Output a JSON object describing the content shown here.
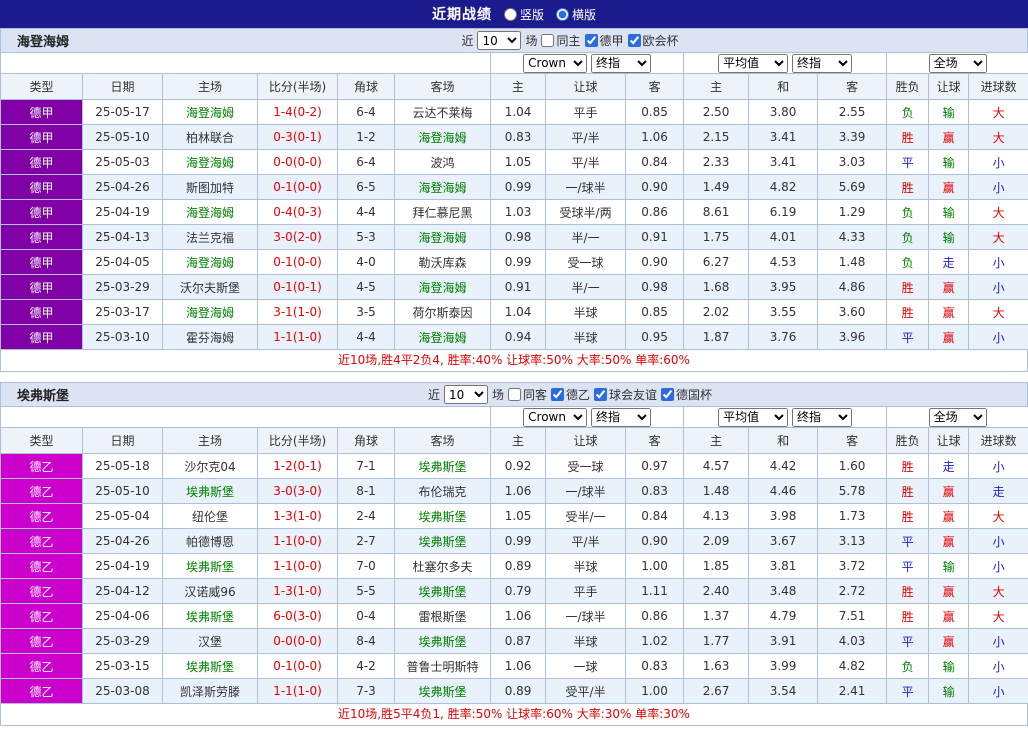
{
  "topbar": {
    "title": "近期战绩",
    "layout_options": [
      {
        "label": "竖版",
        "checked": false
      },
      {
        "label": "横版",
        "checked": true
      }
    ]
  },
  "columns": [
    "类型",
    "日期",
    "主场",
    "比分(半场)",
    "角球",
    "客场",
    "主",
    "让球",
    "客",
    "主",
    "和",
    "客",
    "胜负",
    "让球",
    "进球数"
  ],
  "colors": {
    "topbar_bg": "#1b1b8e",
    "league_bundesliga": "#8000a6",
    "league_bundesliga2": "#cc00cc",
    "focus_team": "#008000",
    "win_red": "#e60000",
    "draw_blue": "#1f1fc8",
    "loss_green": "#008000",
    "row_alt": "#e9f1fb",
    "grid": "#aebfd9"
  },
  "sections": [
    {
      "team": "海登海姆",
      "filter": {
        "prefix": "近",
        "count": "10",
        "suffix": "场",
        "checks": [
          {
            "label": "同主",
            "checked": false
          },
          {
            "label": "德甲",
            "checked": true
          },
          {
            "label": "欧会杯",
            "checked": true
          }
        ]
      },
      "selects": {
        "company": "Crown",
        "ah_final": "终指",
        "eu_avg": "平均值",
        "eu_final": "终指",
        "scope": "全场"
      },
      "summary": "近10场,胜4平2负4, 胜率:40% 让球率:50% 大率:50% 单率:60%",
      "rows": [
        {
          "league": "德甲",
          "league_c": "purple",
          "date": "25-05-17",
          "home": "海登海姆",
          "home_c": "green",
          "score": "1-4(0-2)",
          "corner": "6-4",
          "away": "云达不莱梅",
          "away_c": "dark",
          "ah_home": "1.04",
          "ah_line": "平手",
          "ah_away": "0.85",
          "eu_home": "2.50",
          "eu_draw": "3.80",
          "eu_away": "2.55",
          "result": "负",
          "result_c": "green",
          "handicap": "输",
          "handicap_c": "green",
          "goals": "大",
          "goals_c": "red"
        },
        {
          "league": "德甲",
          "league_c": "purple",
          "date": "25-05-10",
          "home": "柏林联合",
          "home_c": "dark",
          "score": "0-3(0-1)",
          "corner": "1-2",
          "away": "海登海姆",
          "away_c": "green",
          "ah_home": "0.83",
          "ah_line": "平/半",
          "ah_away": "1.06",
          "eu_home": "2.15",
          "eu_draw": "3.41",
          "eu_away": "3.39",
          "result": "胜",
          "result_c": "red",
          "handicap": "赢",
          "handicap_c": "red",
          "goals": "大",
          "goals_c": "red"
        },
        {
          "league": "德甲",
          "league_c": "purple",
          "date": "25-05-03",
          "home": "海登海姆",
          "home_c": "green",
          "score": "0-0(0-0)",
          "corner": "6-4",
          "away": "波鸿",
          "away_c": "dark",
          "ah_home": "1.05",
          "ah_line": "平/半",
          "ah_away": "0.84",
          "eu_home": "2.33",
          "eu_draw": "3.41",
          "eu_away": "3.03",
          "result": "平",
          "result_c": "blue",
          "handicap": "输",
          "handicap_c": "green",
          "goals": "小",
          "goals_c": "blue"
        },
        {
          "league": "德甲",
          "league_c": "purple",
          "date": "25-04-26",
          "home": "斯图加特",
          "home_c": "dark",
          "score": "0-1(0-0)",
          "corner": "6-5",
          "away": "海登海姆",
          "away_c": "green",
          "ah_home": "0.99",
          "ah_line": "一/球半",
          "ah_away": "0.90",
          "eu_home": "1.49",
          "eu_draw": "4.82",
          "eu_away": "5.69",
          "result": "胜",
          "result_c": "red",
          "handicap": "赢",
          "handicap_c": "red",
          "goals": "小",
          "goals_c": "blue"
        },
        {
          "league": "德甲",
          "league_c": "purple",
          "date": "25-04-19",
          "home": "海登海姆",
          "home_c": "green",
          "score": "0-4(0-3)",
          "corner": "4-4",
          "away": "拜仁慕尼黑",
          "away_c": "dark",
          "ah_home": "1.03",
          "ah_line": "受球半/两",
          "ah_away": "0.86",
          "eu_home": "8.61",
          "eu_draw": "6.19",
          "eu_away": "1.29",
          "result": "负",
          "result_c": "green",
          "handicap": "输",
          "handicap_c": "green",
          "goals": "大",
          "goals_c": "red"
        },
        {
          "league": "德甲",
          "league_c": "purple",
          "date": "25-04-13",
          "home": "法兰克福",
          "home_c": "dark",
          "score": "3-0(2-0)",
          "corner": "5-3",
          "away": "海登海姆",
          "away_c": "green",
          "ah_home": "0.98",
          "ah_line": "半/一",
          "ah_away": "0.91",
          "eu_home": "1.75",
          "eu_draw": "4.01",
          "eu_away": "4.33",
          "result": "负",
          "result_c": "green",
          "handicap": "输",
          "handicap_c": "green",
          "goals": "大",
          "goals_c": "red"
        },
        {
          "league": "德甲",
          "league_c": "purple",
          "date": "25-04-05",
          "home": "海登海姆",
          "home_c": "green",
          "score": "0-1(0-0)",
          "corner": "4-0",
          "away": "勒沃库森",
          "away_c": "dark",
          "ah_home": "0.99",
          "ah_line": "受一球",
          "ah_away": "0.90",
          "eu_home": "6.27",
          "eu_draw": "4.53",
          "eu_away": "1.48",
          "result": "负",
          "result_c": "green",
          "handicap": "走",
          "handicap_c": "blue",
          "goals": "小",
          "goals_c": "blue"
        },
        {
          "league": "德甲",
          "league_c": "purple",
          "date": "25-03-29",
          "home": "沃尔夫斯堡",
          "home_c": "dark",
          "score": "0-1(0-1)",
          "corner": "4-5",
          "away": "海登海姆",
          "away_c": "green",
          "ah_home": "0.91",
          "ah_line": "半/一",
          "ah_away": "0.98",
          "eu_home": "1.68",
          "eu_draw": "3.95",
          "eu_away": "4.86",
          "result": "胜",
          "result_c": "red",
          "handicap": "赢",
          "handicap_c": "red",
          "goals": "小",
          "goals_c": "blue"
        },
        {
          "league": "德甲",
          "league_c": "purple",
          "date": "25-03-17",
          "home": "海登海姆",
          "home_c": "green",
          "score": "3-1(1-0)",
          "corner": "3-5",
          "away": "荷尔斯泰因",
          "away_c": "dark",
          "ah_home": "1.04",
          "ah_line": "半球",
          "ah_away": "0.85",
          "eu_home": "2.02",
          "eu_draw": "3.55",
          "eu_away": "3.60",
          "result": "胜",
          "result_c": "red",
          "handicap": "赢",
          "handicap_c": "red",
          "goals": "大",
          "goals_c": "red"
        },
        {
          "league": "德甲",
          "league_c": "purple",
          "date": "25-03-10",
          "home": "霍芬海姆",
          "home_c": "dark",
          "score": "1-1(1-0)",
          "corner": "4-4",
          "away": "海登海姆",
          "away_c": "green",
          "ah_home": "0.94",
          "ah_line": "半球",
          "ah_away": "0.95",
          "eu_home": "1.87",
          "eu_draw": "3.76",
          "eu_away": "3.96",
          "result": "平",
          "result_c": "blue",
          "handicap": "赢",
          "handicap_c": "red",
          "goals": "小",
          "goals_c": "blue"
        }
      ]
    },
    {
      "team": "埃弗斯堡",
      "filter": {
        "prefix": "近",
        "count": "10",
        "suffix": "场",
        "checks": [
          {
            "label": "同客",
            "checked": false
          },
          {
            "label": "德乙",
            "checked": true
          },
          {
            "label": "球会友谊",
            "checked": true
          },
          {
            "label": "德国杯",
            "checked": true
          }
        ]
      },
      "selects": {
        "company": "Crown",
        "ah_final": "终指",
        "eu_avg": "平均值",
        "eu_final": "终指",
        "scope": "全场"
      },
      "summary": "近10场,胜5平4负1, 胜率:50% 让球率:60% 大率:30% 单率:30%",
      "rows": [
        {
          "league": "德乙",
          "league_c": "magenta",
          "date": "25-05-18",
          "home": "沙尔克04",
          "home_c": "dark",
          "score": "1-2(0-1)",
          "corner": "7-1",
          "away": "埃弗斯堡",
          "away_c": "green",
          "ah_home": "0.92",
          "ah_line": "受一球",
          "ah_away": "0.97",
          "eu_home": "4.57",
          "eu_draw": "4.42",
          "eu_away": "1.60",
          "result": "胜",
          "result_c": "red",
          "handicap": "走",
          "handicap_c": "blue",
          "goals": "小",
          "goals_c": "blue"
        },
        {
          "league": "德乙",
          "league_c": "magenta",
          "date": "25-05-10",
          "home": "埃弗斯堡",
          "home_c": "green",
          "score": "3-0(3-0)",
          "corner": "8-1",
          "away": "布伦瑞克",
          "away_c": "dark",
          "ah_home": "1.06",
          "ah_line": "一/球半",
          "ah_away": "0.83",
          "eu_home": "1.48",
          "eu_draw": "4.46",
          "eu_away": "5.78",
          "result": "胜",
          "result_c": "red",
          "handicap": "赢",
          "handicap_c": "red",
          "goals": "走",
          "goals_c": "blue"
        },
        {
          "league": "德乙",
          "league_c": "magenta",
          "date": "25-05-04",
          "home": "纽伦堡",
          "home_c": "dark",
          "score": "1-3(1-0)",
          "corner": "2-4",
          "away": "埃弗斯堡",
          "away_c": "green",
          "ah_home": "1.05",
          "ah_line": "受半/一",
          "ah_away": "0.84",
          "eu_home": "4.13",
          "eu_draw": "3.98",
          "eu_away": "1.73",
          "result": "胜",
          "result_c": "red",
          "handicap": "赢",
          "handicap_c": "red",
          "goals": "大",
          "goals_c": "red"
        },
        {
          "league": "德乙",
          "league_c": "magenta",
          "date": "25-04-26",
          "home": "帕德博恩",
          "home_c": "dark",
          "score": "1-1(0-0)",
          "corner": "2-7",
          "away": "埃弗斯堡",
          "away_c": "green",
          "ah_home": "0.99",
          "ah_line": "平/半",
          "ah_away": "0.90",
          "eu_home": "2.09",
          "eu_draw": "3.67",
          "eu_away": "3.13",
          "result": "平",
          "result_c": "blue",
          "handicap": "赢",
          "handicap_c": "red",
          "goals": "小",
          "goals_c": "blue"
        },
        {
          "league": "德乙",
          "league_c": "magenta",
          "date": "25-04-19",
          "home": "埃弗斯堡",
          "home_c": "green",
          "score": "1-1(0-0)",
          "corner": "7-0",
          "away": "杜塞尔多夫",
          "away_c": "dark",
          "ah_home": "0.89",
          "ah_line": "半球",
          "ah_away": "1.00",
          "eu_home": "1.85",
          "eu_draw": "3.81",
          "eu_away": "3.72",
          "result": "平",
          "result_c": "blue",
          "handicap": "输",
          "handicap_c": "green",
          "goals": "小",
          "goals_c": "blue"
        },
        {
          "league": "德乙",
          "league_c": "magenta",
          "date": "25-04-12",
          "home": "汉诺威96",
          "home_c": "dark",
          "score": "1-3(1-0)",
          "corner": "5-5",
          "away": "埃弗斯堡",
          "away_c": "green",
          "ah_home": "0.79",
          "ah_line": "平手",
          "ah_away": "1.11",
          "eu_home": "2.40",
          "eu_draw": "3.48",
          "eu_away": "2.72",
          "result": "胜",
          "result_c": "red",
          "handicap": "赢",
          "handicap_c": "red",
          "goals": "大",
          "goals_c": "red"
        },
        {
          "league": "德乙",
          "league_c": "magenta",
          "date": "25-04-06",
          "home": "埃弗斯堡",
          "home_c": "green",
          "score": "6-0(3-0)",
          "corner": "0-4",
          "away": "雷根斯堡",
          "away_c": "dark",
          "ah_home": "1.06",
          "ah_line": "一/球半",
          "ah_away": "0.86",
          "eu_home": "1.37",
          "eu_draw": "4.79",
          "eu_away": "7.51",
          "result": "胜",
          "result_c": "red",
          "handicap": "赢",
          "handicap_c": "red",
          "goals": "大",
          "goals_c": "red"
        },
        {
          "league": "德乙",
          "league_c": "magenta",
          "date": "25-03-29",
          "home": "汉堡",
          "home_c": "dark",
          "score": "0-0(0-0)",
          "corner": "8-4",
          "away": "埃弗斯堡",
          "away_c": "green",
          "ah_home": "0.87",
          "ah_line": "半球",
          "ah_away": "1.02",
          "eu_home": "1.77",
          "eu_draw": "3.91",
          "eu_away": "4.03",
          "result": "平",
          "result_c": "blue",
          "handicap": "赢",
          "handicap_c": "red",
          "goals": "小",
          "goals_c": "blue"
        },
        {
          "league": "德乙",
          "league_c": "magenta",
          "date": "25-03-15",
          "home": "埃弗斯堡",
          "home_c": "green",
          "score": "0-1(0-0)",
          "corner": "4-2",
          "away": "普鲁士明斯特",
          "away_c": "dark",
          "ah_home": "1.06",
          "ah_line": "一球",
          "ah_away": "0.83",
          "eu_home": "1.63",
          "eu_draw": "3.99",
          "eu_away": "4.82",
          "result": "负",
          "result_c": "green",
          "handicap": "输",
          "handicap_c": "green",
          "goals": "小",
          "goals_c": "blue"
        },
        {
          "league": "德乙",
          "league_c": "magenta",
          "date": "25-03-08",
          "home": "凯泽斯劳滕",
          "home_c": "dark",
          "score": "1-1(1-0)",
          "corner": "7-3",
          "away": "埃弗斯堡",
          "away_c": "green",
          "ah_home": "0.89",
          "ah_line": "受平/半",
          "ah_away": "1.00",
          "eu_home": "2.67",
          "eu_draw": "3.54",
          "eu_away": "2.41",
          "result": "平",
          "result_c": "blue",
          "handicap": "输",
          "handicap_c": "green",
          "goals": "小",
          "goals_c": "blue"
        }
      ]
    }
  ]
}
